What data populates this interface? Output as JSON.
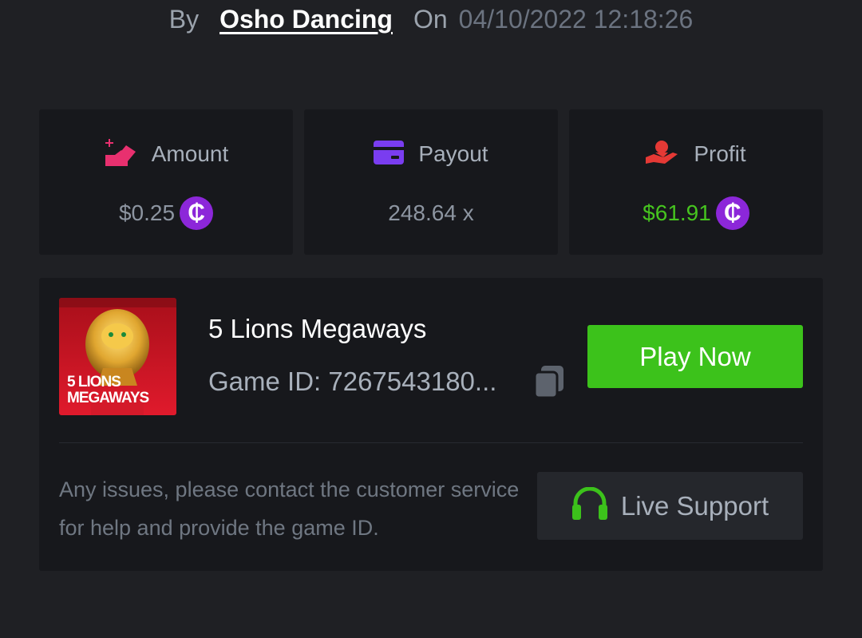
{
  "byline": {
    "by_label": "By",
    "username": "Osho Dancing",
    "on_label": "On",
    "datetime": "04/10/2022 12:18:26"
  },
  "stats": {
    "amount": {
      "label": "Amount",
      "value": "$0.25",
      "icon": "bet-hand-icon",
      "icon_color": "#e8306f",
      "coin_symbol": "₵"
    },
    "payout": {
      "label": "Payout",
      "value": "248.64 x",
      "icon": "credit-card-icon",
      "icon_color": "#7a3df0"
    },
    "profit": {
      "label": "Profit",
      "value": "$61.91",
      "icon": "money-hand-icon",
      "icon_color": "#e53935",
      "value_color": "#46c41f",
      "coin_symbol": "₵"
    }
  },
  "game": {
    "title": "5 Lions Megaways",
    "id_text": "Game ID: 7267543180...",
    "thumbnail_text_line1": "5 LIONS",
    "thumbnail_text_line2": "MEGAWAYS",
    "play_label": "Play Now",
    "help_text": "Any issues, please contact the customer service for help and provide the game ID.",
    "support_label": "Live Support"
  },
  "colors": {
    "background": "#1f2024",
    "card": "#17181c",
    "accent_green": "#3cc21b",
    "coin_purple": "#8c27d9"
  }
}
